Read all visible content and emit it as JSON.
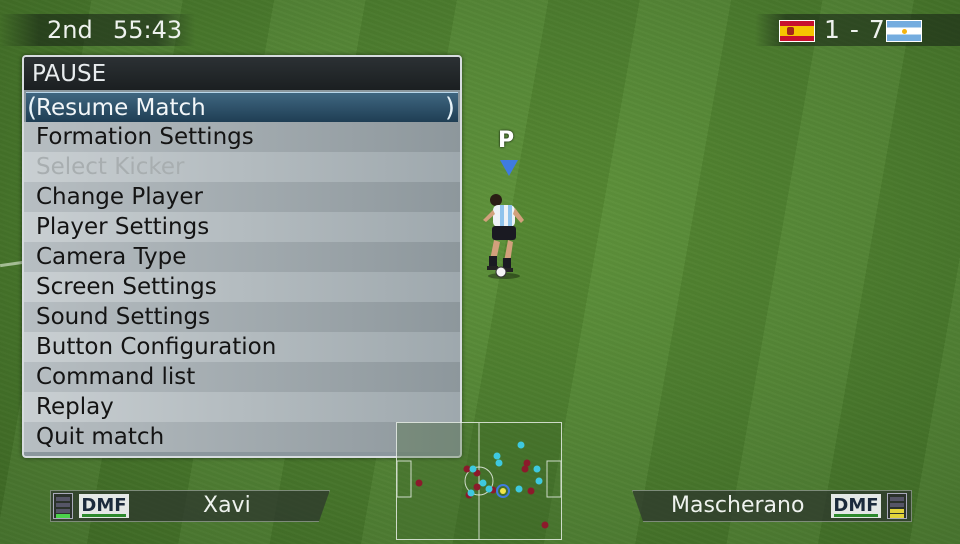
{
  "hud": {
    "half": "2nd",
    "clock": "55:43",
    "score": "1 - 7",
    "home_flag": "spain-flag",
    "away_flag": "argentina-flag"
  },
  "pause_menu": {
    "title": "PAUSE",
    "items": [
      {
        "label": "Resume Match",
        "state": "selected"
      },
      {
        "label": "Formation Settings",
        "state": "enabled"
      },
      {
        "label": "Select Kicker",
        "state": "disabled"
      },
      {
        "label": "Change Player",
        "state": "enabled"
      },
      {
        "label": "Player Settings",
        "state": "enabled"
      },
      {
        "label": "Camera Type",
        "state": "enabled"
      },
      {
        "label": "Screen Settings",
        "state": "enabled"
      },
      {
        "label": "Sound Settings",
        "state": "enabled"
      },
      {
        "label": "Button Configuration",
        "state": "enabled"
      },
      {
        "label": "Command list",
        "state": "enabled"
      },
      {
        "label": "Replay",
        "state": "enabled"
      },
      {
        "label": "Quit match",
        "state": "enabled"
      }
    ]
  },
  "player_marker": {
    "label": "P",
    "color": "#3f7be0"
  },
  "home_player": {
    "position": "DMF",
    "name": "Xavi"
  },
  "away_player": {
    "position": "DMF",
    "name": "Mascherano"
  },
  "colors": {
    "home_team": "#8b1a2b",
    "away_team": "#3ec9e0",
    "selection": "#2b4f68"
  }
}
